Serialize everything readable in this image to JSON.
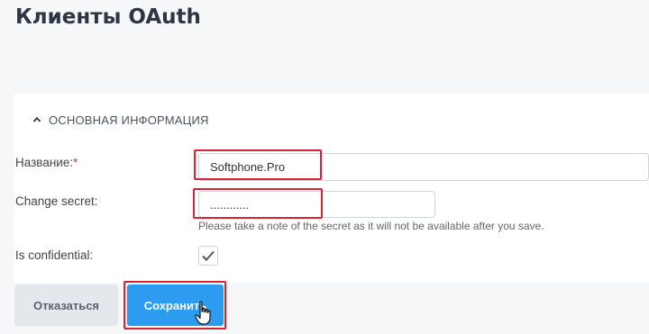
{
  "page": {
    "title": "Клиенты OAuth"
  },
  "section": {
    "title": "ОСНОВНАЯ ИНФОРМАЦИЯ",
    "toggle_icon": "chevron-up-icon"
  },
  "form": {
    "name": {
      "label": "Название:",
      "required_mark": "*",
      "value": "Softphone.Pro"
    },
    "secret": {
      "label": "Change secret:",
      "value": "............",
      "hint": "Please take a note of the secret as it will not be available after you save."
    },
    "confidential": {
      "label": "Is confidential:",
      "checked": true
    }
  },
  "actions": {
    "cancel_label": "Отказаться",
    "save_label": "Сохранить"
  },
  "colors": {
    "highlight": "#d9232e",
    "primary": "#2d9bf0"
  }
}
